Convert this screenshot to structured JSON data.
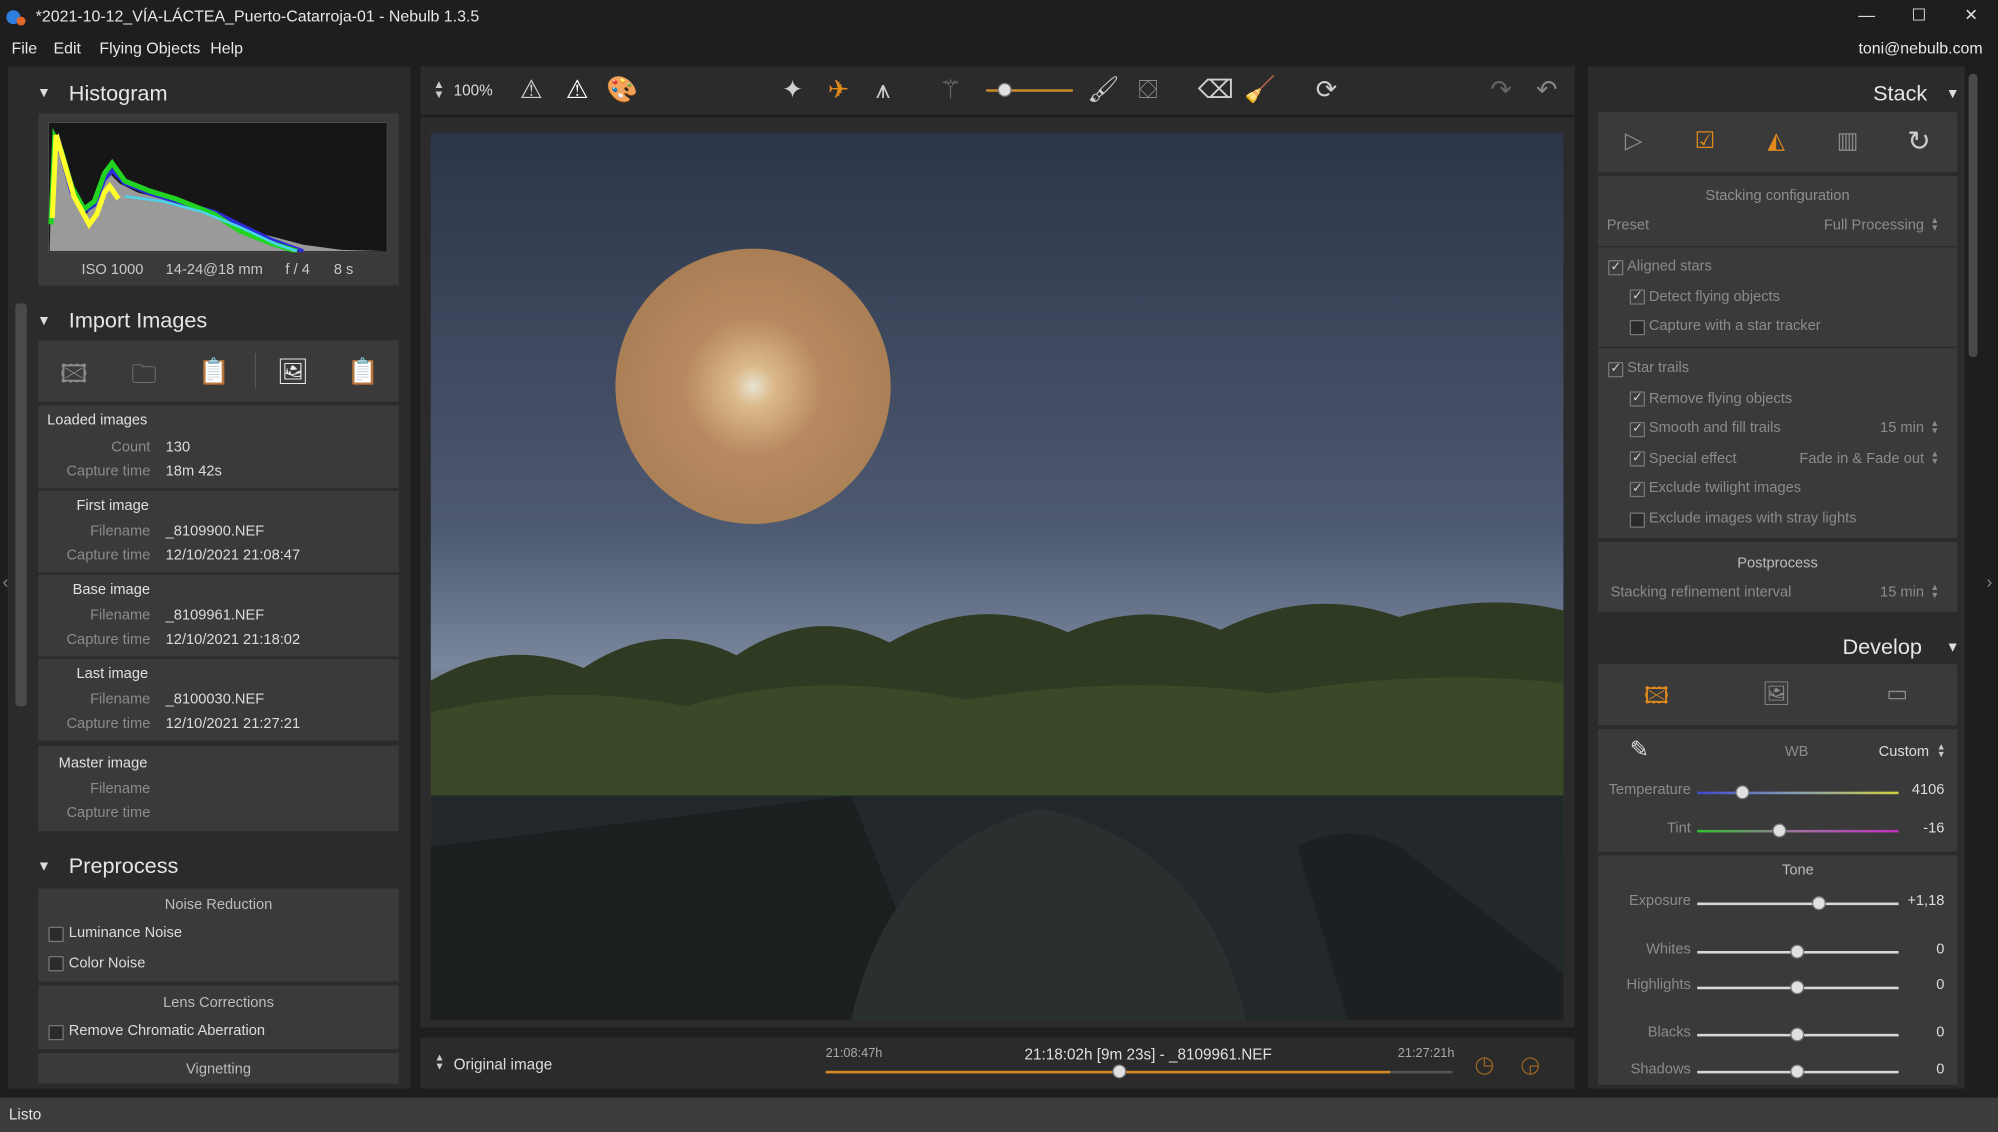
{
  "window": {
    "title": "*2021-10-12_VÍA-LÁCTEA_Puerto-Catarroja-01 - Nebulb 1.3.5",
    "minimize": "—",
    "maximize": "☐",
    "close": "✕"
  },
  "menu": [
    "File",
    "Edit",
    "Flying Objects",
    "Help"
  ],
  "user": "toni@nebulb.com",
  "histogram": {
    "title": "Histogram",
    "iso": "ISO 1000",
    "lens": "14-24@18 mm",
    "aperture": "f / 4",
    "exposure": "8 s"
  },
  "import": {
    "title": "Import Images",
    "loaded": {
      "heading": "Loaded images",
      "count_label": "Count",
      "count": "130",
      "time_label": "Capture time",
      "time": "18m 42s"
    },
    "first": {
      "heading": "First image",
      "file_label": "Filename",
      "file": "_8109900.NEF",
      "time_label": "Capture time",
      "time": "12/10/2021 21:08:47"
    },
    "base": {
      "heading": "Base image",
      "file_label": "Filename",
      "file": "_8109961.NEF",
      "time_label": "Capture time",
      "time": "12/10/2021 21:18:02"
    },
    "last": {
      "heading": "Last image",
      "file_label": "Filename",
      "file": "_8100030.NEF",
      "time_label": "Capture time",
      "time": "12/10/2021 21:27:21"
    },
    "master": {
      "heading": "Master image",
      "file_label": "Filename",
      "time_label": "Capture time"
    }
  },
  "preprocess": {
    "title": "Preprocess",
    "noise": "Noise Reduction",
    "lum": "Luminance Noise",
    "color": "Color Noise",
    "lens": "Lens Corrections",
    "chrom": "Remove Chromatic Aberration",
    "vignetting": "Vignetting"
  },
  "toolbar": {
    "zoom": "100%"
  },
  "bottom": {
    "view": "Original image",
    "start": "21:08:47h",
    "current": "21:18:02h [9m 23s] - _8109961.NEF",
    "end": "21:27:21h",
    "progress": 0.47
  },
  "stack": {
    "title": "Stack",
    "config": "Stacking configuration",
    "preset_label": "Preset",
    "preset": "Full Processing",
    "aligned": "Aligned stars",
    "detect": "Detect flying objects",
    "tracker": "Capture with a star tracker",
    "trails": "Star trails",
    "remove": "Remove flying objects",
    "smooth": "Smooth and fill trails",
    "smooth_val": "15 min",
    "special": "Special effect",
    "special_val": "Fade in & Fade out",
    "twilight": "Exclude twilight images",
    "stray": "Exclude images with stray lights",
    "post": "Postprocess",
    "refine": "Stacking refinement interval",
    "refine_val": "15 min"
  },
  "develop": {
    "title": "Develop",
    "wb_label": "WB",
    "wb": "Custom",
    "temp_label": "Temperature",
    "temp": "4106",
    "temp_pos": 0.23,
    "tint_label": "Tint",
    "tint": "-16",
    "tint_pos": 0.41,
    "tone": "Tone",
    "exposure_label": "Exposure",
    "exposure": "+1,18",
    "exposure_pos": 0.61,
    "whites_label": "Whites",
    "whites": "0",
    "whites_pos": 0.5,
    "highlights_label": "Highlights",
    "highlights": "0",
    "highlights_pos": 0.5,
    "blacks_label": "Blacks",
    "blacks": "0",
    "blacks_pos": 0.5,
    "shadows_label": "Shadows",
    "shadows": "0",
    "shadows_pos": 0.5
  },
  "status": "Listo"
}
